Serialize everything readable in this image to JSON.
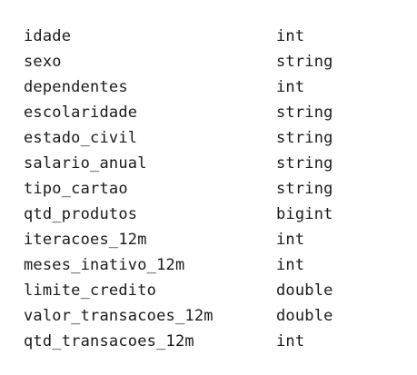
{
  "schema": {
    "rows": [
      {
        "name": "idade",
        "type": "int"
      },
      {
        "name": "sexo",
        "type": "string"
      },
      {
        "name": "dependentes",
        "type": "int"
      },
      {
        "name": "escolaridade",
        "type": "string"
      },
      {
        "name": "estado_civil",
        "type": "string"
      },
      {
        "name": "salario_anual",
        "type": "string"
      },
      {
        "name": "tipo_cartao",
        "type": "string"
      },
      {
        "name": "qtd_produtos",
        "type": "bigint"
      },
      {
        "name": "iteracoes_12m",
        "type": "int"
      },
      {
        "name": "meses_inativo_12m",
        "type": "int"
      },
      {
        "name": "limite_credito",
        "type": "double"
      },
      {
        "name": "valor_transacoes_12m",
        "type": "double"
      },
      {
        "name": "qtd_transacoes_12m",
        "type": "int"
      }
    ]
  }
}
